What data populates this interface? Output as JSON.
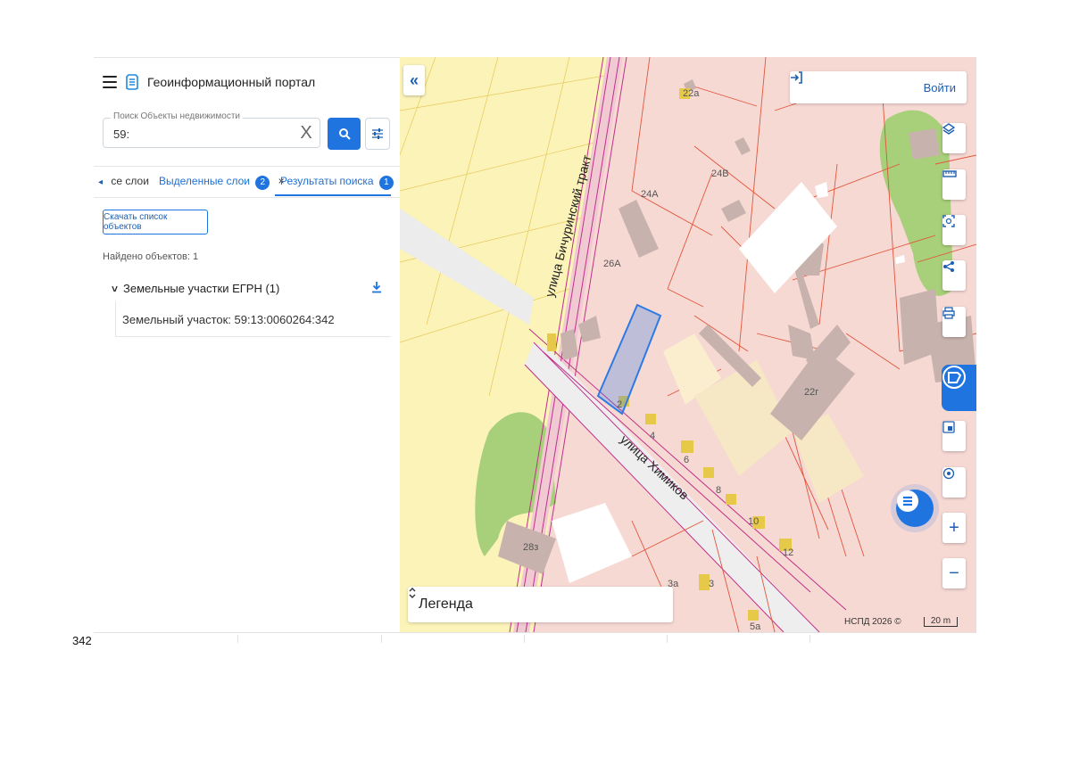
{
  "app": {
    "title": "Геоинформационный портал"
  },
  "search": {
    "label": "Поиск Объекты недвижимости",
    "value": "59:",
    "clear_symbol": "X"
  },
  "tabs": [
    {
      "label": "се слои",
      "prefix": "◂"
    },
    {
      "label": "Выделенные слои",
      "badge": "2",
      "close": "×"
    },
    {
      "label": "Результаты поиска",
      "badge": "1",
      "close": "×"
    }
  ],
  "results": {
    "download_list_label": "Скачать список объектов",
    "found_label": "Найдено объектов: 1",
    "group_label": "Земельные участки ЕГРН (1)",
    "group_chevron": "˅",
    "items": [
      "Земельный участок: 59:13:0060264:342"
    ]
  },
  "map": {
    "collapse_symbol": "«",
    "login_label": "Войти",
    "legend_label": "Легенда",
    "legend_toggle": "⌃⌄",
    "attribution": "НСПД 2026 ©",
    "scale_label": "20 m",
    "street_labels": [
      "улица Бичуринский тракт",
      "улица Химиков"
    ],
    "house_numbers": [
      "22а",
      "24В",
      "24А",
      "26А",
      "22г",
      "2",
      "4",
      "6",
      "8",
      "10",
      "12",
      "28з",
      "3а",
      "3",
      "5а"
    ],
    "tools": [
      "layers-icon",
      "ruler-icon",
      "select-area-icon",
      "share-icon",
      "print-icon",
      "layer-panel-icon",
      "minimap-icon",
      "location-icon",
      "zoom-in-icon",
      "zoom-out-icon"
    ],
    "zoom_in": "+",
    "zoom_out": "−"
  },
  "footer": {
    "page_number": "342"
  },
  "colors": {
    "accent": "#1f74e0",
    "parcel_fill": "#f7d9d4",
    "field_fill": "#fbf3b8",
    "green": "#a8cf7a",
    "building": "#c7b2ad",
    "boundary_pink": "#c0308a",
    "boundary_red": "#e0553c",
    "selection": "#2c7be5"
  }
}
